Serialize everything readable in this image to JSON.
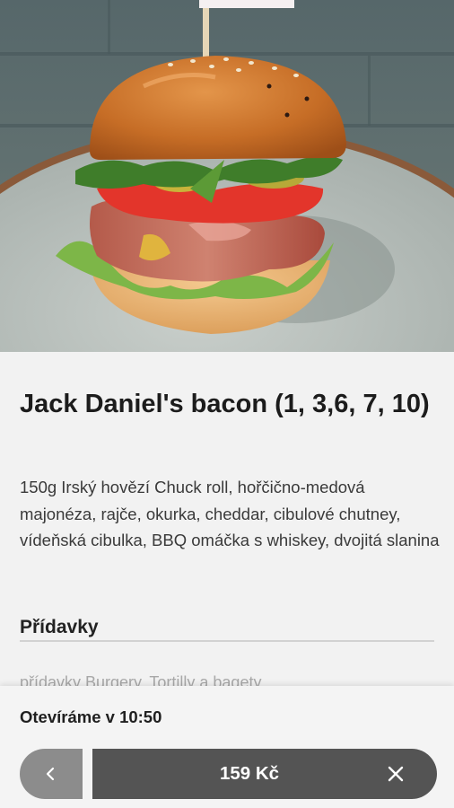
{
  "product": {
    "title": "Jack Daniel's bacon (1, 3,6, 7, 10)",
    "description": "150g Irský hovězí Chuck roll, hořčično-medová majonéza, rajče, okurka, cheddar, cibulové chutney, vídeňská cibulka, BBQ omáčka s whiskey, dvojitá slanina",
    "image_subject": "burger-photo"
  },
  "addons": {
    "section_title": "Přídavky",
    "categories_text": "přídavky Burgery, Tortilly a bagety"
  },
  "bottom_bar": {
    "opening_text": "Otevíráme v 10:50",
    "price_label": "159 Kč",
    "back_icon": "chevron-left-icon",
    "close_icon": "close-icon"
  },
  "colors": {
    "background": "#f2f2f2",
    "price_button": "#545454",
    "back_button": "#8c8c8c",
    "text": "#1c1c1c"
  }
}
